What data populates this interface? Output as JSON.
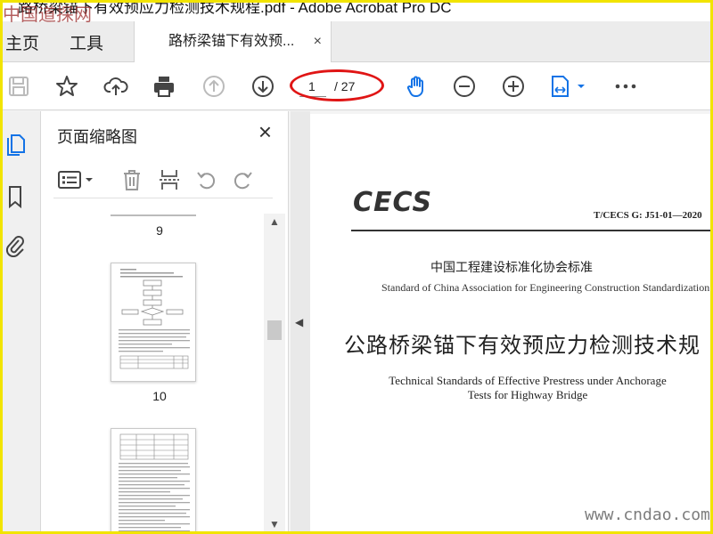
{
  "window": {
    "title": "路桥梁锚下有效预应力检测技术规程.pdf - Adobe Acrobat Pro DC"
  },
  "watermarks": {
    "top_left": "中国道探网",
    "bottom_right": "www.cndao.com"
  },
  "tabs": {
    "home": "主页",
    "tools": "工具",
    "document": "路桥梁锚下有效预...",
    "close": "×"
  },
  "toolbar": {
    "icons": [
      "save-icon",
      "star-icon",
      "upload-icon",
      "print-icon",
      "page-up-icon",
      "page-down-icon",
      "hand-icon",
      "zoom-out-icon",
      "zoom-in-icon",
      "fit-page-icon",
      "more-icon"
    ],
    "current_page": "1",
    "total_pages": "/ 27",
    "accent": "#1473e6",
    "highlight": "#e01515"
  },
  "panel": {
    "title": "页面缩略图",
    "close": "×",
    "thumbnails": [
      {
        "label": "9"
      },
      {
        "label": "10"
      },
      {
        "label": ""
      }
    ]
  },
  "document": {
    "logo": "CECS",
    "code": "T/CECS G: J51-01—2020",
    "assoc_cn": "中国工程建设标准化协会标准",
    "assoc_en": "Standard of China Association for Engineering Construction Standardization",
    "title_cn": "公路桥梁锚下有效预应力检测技术规",
    "title_en_1": "Technical Standards of Effective Prestress under Anchorage",
    "title_en_2": "Tests for Highway Bridge"
  }
}
